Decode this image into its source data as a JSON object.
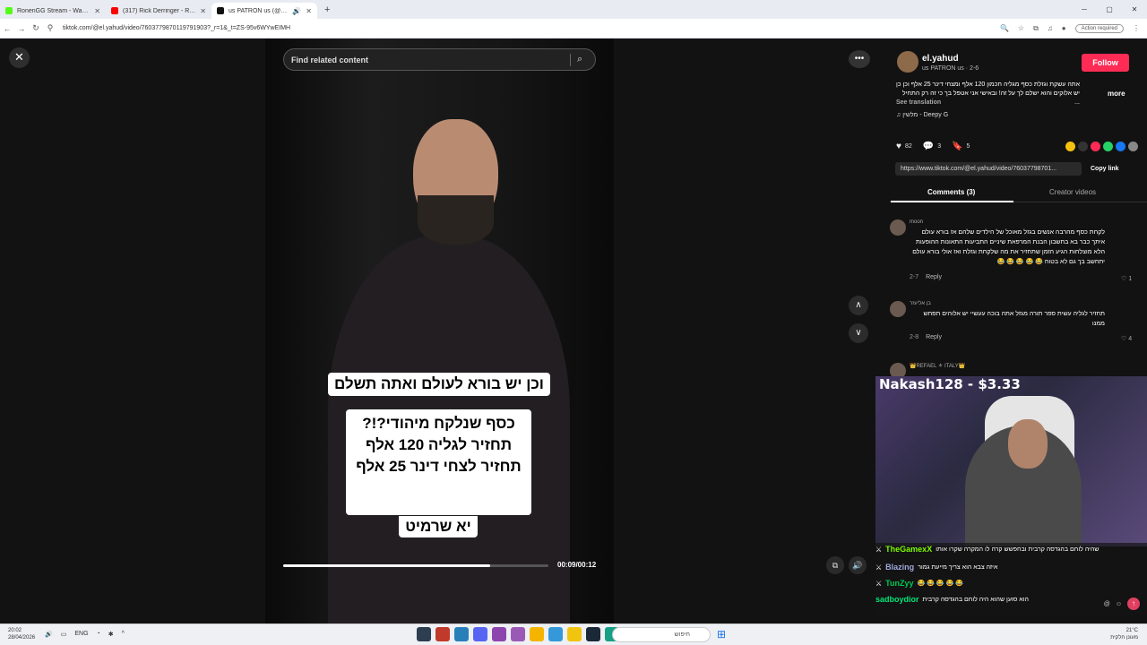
{
  "browser": {
    "tabs": [
      {
        "title": "RonenGG Stream - Watch Live",
        "color": "#53fc18"
      },
      {
        "title": "(317) Rick Derringer - Real Ame",
        "color": "#ff0000"
      },
      {
        "title": "us PATRON us (@el.yahud)",
        "color": "#111111"
      }
    ],
    "new_tab": "+",
    "url": "tiktok.com/@el.yahud/video/7603779870119791903?_r=1&_t=ZS-95v6WYwEIMH",
    "action_required": "Action required"
  },
  "video": {
    "search_placeholder": "Find related content",
    "caption_line1": "וכן יש בורא לעולם ואתה תשלם",
    "caption_block": [
      "כסף שנלקח מיהודי?!?",
      "תחזיר לגליה 120 אלף",
      "תחזיר לצחי דינר 25 אלף"
    ],
    "caption_last": "יא שרמיט",
    "time": "00:09/00:12",
    "progress": 0.78
  },
  "panel": {
    "author_name": "el.yahud",
    "author_sub": "us PATRON us · 2-6",
    "follow_label": "Follow",
    "description": "אתה עשקת וגזלת כסף מגליה חכמון 120 אלף ומצחי דינר 25 אלף וכן כן יש אלוקים והוא ישלם לך על זה! ובאישי אני אטפל בך כי זה רק התחיל ...",
    "more_label": "more",
    "see_translation": "See translation",
    "music": "מלשין - Deepy G",
    "likes": "82",
    "comments_count": "3",
    "saves": "5",
    "link": "https://www.tiktok.com/@el.yahud/video/76037798701...",
    "copy_link": "Copy link",
    "tab_comments": "Comments (3)",
    "tab_creator": "Creator videos",
    "comments": [
      {
        "user": "moon",
        "text": "לקחת כסף מהרבה אנשים בגזל מאוכל של הילדים שלהם אז בורא עולם איתך כבר בא בחשבון הבנת המרפאת שיניים התביעות התאונות ההופעות הלא מוצלחות הגיע הזמן שתחזיר את מה שלקחת וגזלת ואז אולי בורא עולם יתחשב בך גם לא בטוח 😂 😂 😂 😂 😂",
        "date": "2-7",
        "reply": "Reply",
        "likes": "1"
      },
      {
        "user": "בן אליעזר",
        "text": "תחזיר לגליה עשית ספר תורה מגזל אתה בוכה עעשיי יש אלוהים תפחש ממנו",
        "date": "2-8",
        "reply": "Reply",
        "likes": "4"
      },
      {
        "user": "👑REFAEL ⚜ ITALY👑",
        "text": "",
        "date": "",
        "reply": "",
        "likes": ""
      }
    ]
  },
  "overlay": {
    "cam_title": "Nakash128 - $3.33",
    "chat": [
      {
        "user": "TheGamexX",
        "msg": "שהיה לוחם בהגדסה קרבית ובחפשש קרה לו המקרה שקרו אותו",
        "color": "#7cfc00"
      },
      {
        "user": "Blazing",
        "msg": "איזה צבא הוא צריך מייעת גמור",
        "color": "#9fa8da"
      },
      {
        "user": "TunZyy",
        "msg": "😂 😂 😂 😂 😂",
        "color": "#00c853"
      },
      {
        "user": "sadboydior",
        "msg": "הוא סוען שהוא היה לוחם בהגדסה קרבית",
        "color": "#00e676"
      }
    ]
  },
  "taskbar": {
    "time": "20:02",
    "date": "28/04/2026",
    "lang": "ENG",
    "search_placeholder": "חיפוש",
    "temp": "21°C",
    "weather": "מעונן חלקית"
  }
}
